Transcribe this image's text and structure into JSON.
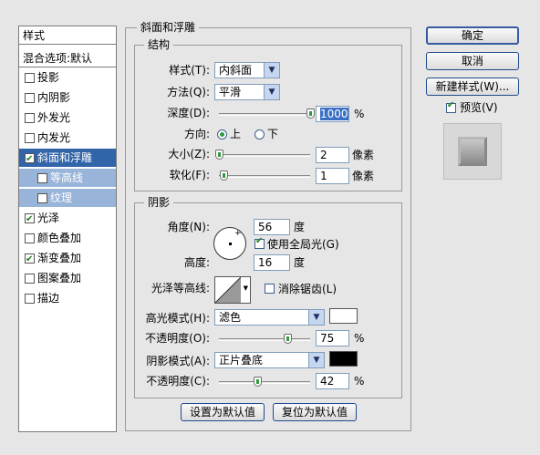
{
  "styles_panel": {
    "header": "样式",
    "blend_options": "混合选项:默认",
    "items": [
      {
        "label": "投影",
        "checked": false
      },
      {
        "label": "内阴影",
        "checked": false
      },
      {
        "label": "外发光",
        "checked": false
      },
      {
        "label": "内发光",
        "checked": false
      },
      {
        "label": "斜面和浮雕",
        "checked": true,
        "selected": true
      },
      {
        "label": "等高线",
        "checked": false,
        "sub": true
      },
      {
        "label": "纹理",
        "checked": false,
        "sub": true
      },
      {
        "label": "光泽",
        "checked": true
      },
      {
        "label": "颜色叠加",
        "checked": false
      },
      {
        "label": "渐变叠加",
        "checked": true
      },
      {
        "label": "图案叠加",
        "checked": false
      },
      {
        "label": "描边",
        "checked": false
      }
    ]
  },
  "main": {
    "title": "斜面和浮雕",
    "structure": {
      "title": "结构",
      "style_label": "样式(T):",
      "style_value": "内斜面",
      "technique_label": "方法(Q):",
      "technique_value": "平滑",
      "depth_label": "深度(D):",
      "depth_value": "1000",
      "depth_unit": "%",
      "depth_fraction": 1.0,
      "direction_label": "方向:",
      "dir_up": "上",
      "dir_down": "下",
      "direction_selected": "上",
      "size_label": "大小(Z):",
      "size_value": "2",
      "size_unit": "像素",
      "size_fraction": 0.0,
      "soften_label": "软化(F):",
      "soften_value": "1",
      "soften_unit": "像素",
      "soften_fraction": 0.05
    },
    "shading": {
      "title": "阴影",
      "angle_label": "角度(N):",
      "angle_value": "56",
      "angle_unit": "度",
      "global_light_label": "使用全局光(G)",
      "global_light_checked": true,
      "altitude_label": "高度:",
      "altitude_value": "16",
      "altitude_unit": "度",
      "gloss_contour_label": "光泽等高线:",
      "anti_alias_label": "消除锯齿(L)",
      "anti_alias_checked": false,
      "highlight_mode_label": "高光模式(H):",
      "highlight_mode_value": "滤色",
      "highlight_color": "#ffffff",
      "highlight_opacity_label": "不透明度(O):",
      "highlight_opacity_value": "75",
      "highlight_opacity_unit": "%",
      "highlight_opacity_fraction": 0.75,
      "shadow_mode_label": "阴影模式(A):",
      "shadow_mode_value": "正片叠底",
      "shadow_color": "#000000",
      "shadow_opacity_label": "不透明度(C):",
      "shadow_opacity_value": "42",
      "shadow_opacity_unit": "%",
      "shadow_opacity_fraction": 0.42
    },
    "make_default": "设置为默认值",
    "reset_default": "复位为默认值"
  },
  "right": {
    "ok": "确定",
    "cancel": "取消",
    "new_style": "新建样式(W)...",
    "preview_label": "预览(V)",
    "preview_checked": true
  }
}
